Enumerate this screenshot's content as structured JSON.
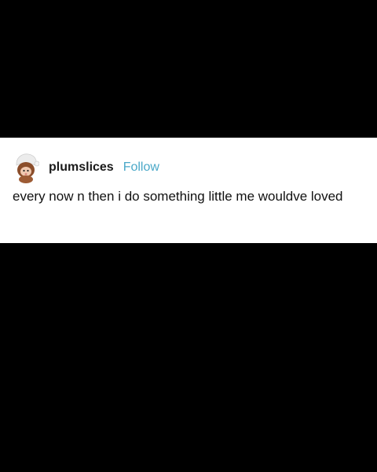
{
  "post": {
    "username": "plumslices",
    "follow_label": "Follow",
    "body_text": "every now n then i do something little me wouldve loved",
    "avatar_icon": "monchhichi-avatar-icon"
  },
  "colors": {
    "background": "#000000",
    "card": "#ffffff",
    "follow": "#4aa8c8",
    "text": "#111111"
  }
}
